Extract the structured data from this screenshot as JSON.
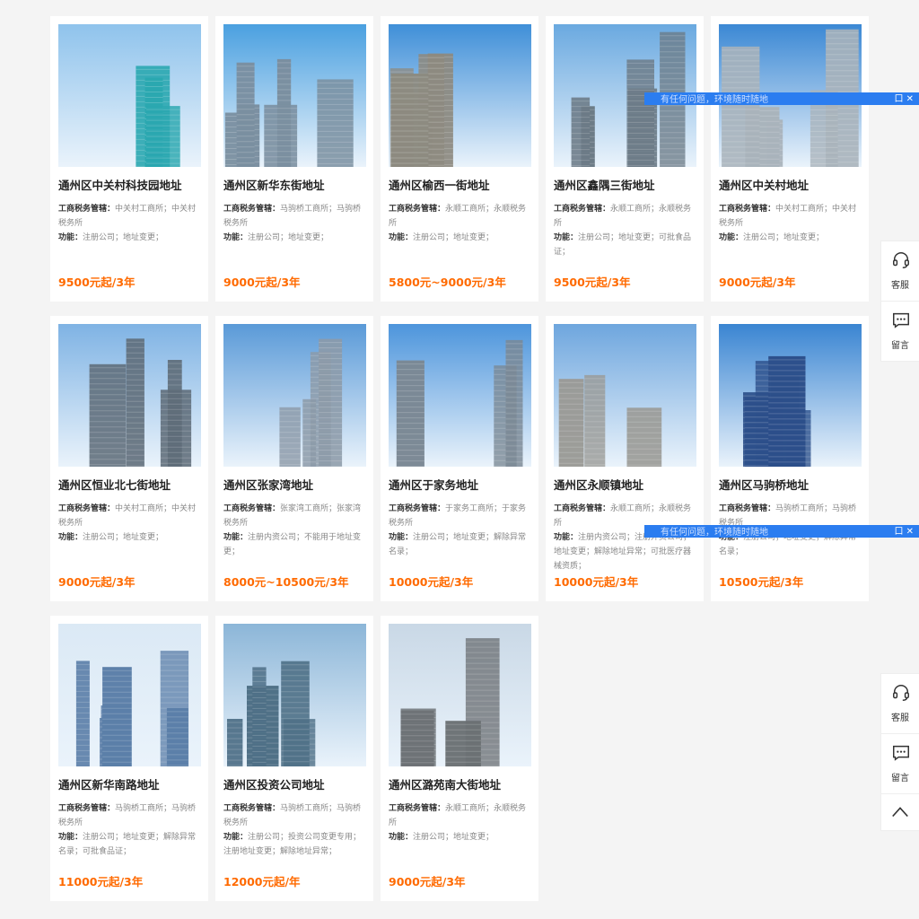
{
  "cards": [
    {
      "title": "通州区中关村科技园地址",
      "tax_label": "工商税务管辖：",
      "tax": "中关村工商所；中关村税务所",
      "func_label": "功能：",
      "func": "注册公司；地址变更；",
      "price": "9500元起/3年"
    },
    {
      "title": "通州区新华东街地址",
      "tax_label": "工商税务管辖：",
      "tax": "马驹桥工商所；马驹桥税务所",
      "func_label": "功能：",
      "func": "注册公司；地址变更；",
      "price": "9000元起/3年"
    },
    {
      "title": "通州区榆西一街地址",
      "tax_label": "工商税务管辖：",
      "tax": "永顺工商所；永顺税务所",
      "func_label": "功能：",
      "func": "注册公司；地址变更；",
      "price": "5800元~9000元/3年"
    },
    {
      "title": "通州区鑫隅三街地址",
      "tax_label": "工商税务管辖：",
      "tax": "永顺工商所；永顺税务所",
      "func_label": "功能：",
      "func": "注册公司；地址变更；可批食品证；",
      "price": "9500元起/3年"
    },
    {
      "title": "通州区中关村地址",
      "tax_label": "工商税务管辖：",
      "tax": "中关村工商所；中关村税务所",
      "func_label": "功能：",
      "func": "注册公司；地址变更；",
      "price": "9000元起/3年"
    },
    {
      "title": "通州区恒业北七街地址",
      "tax_label": "工商税务管辖：",
      "tax": "中关村工商所；中关村税务所",
      "func_label": "功能：",
      "func": "注册公司；地址变更；",
      "price": "9000元起/3年"
    },
    {
      "title": "通州区张家湾地址",
      "tax_label": "工商税务管辖：",
      "tax": "张家湾工商所；张家湾税务所",
      "func_label": "功能：",
      "func": "注册内资公司；不能用于地址变更；",
      "price": "8000元~10500元/3年"
    },
    {
      "title": "通州区于家务地址",
      "tax_label": "工商税务管辖：",
      "tax": "于家务工商所；于家务税务所",
      "func_label": "功能：",
      "func": "注册公司；地址变更；解除异常名录；",
      "price": "10000元起/3年"
    },
    {
      "title": "通州区永顺镇地址",
      "tax_label": "工商税务管辖：",
      "tax": "永顺工商所；永顺税务所",
      "func_label": "功能：",
      "func": "注册内资公司；注册外资公司；地址变更；解除地址异常；可批医疗器械资质；",
      "price": "10000元起/3年"
    },
    {
      "title": "通州区马驹桥地址",
      "tax_label": "工商税务管辖：",
      "tax": "马驹桥工商所；马驹桥税务所",
      "func_label": "功能：",
      "func": "注册公司；地址变更；解除异常名录；",
      "price": "10500元起/3年"
    },
    {
      "title": "通州区新华南路地址",
      "tax_label": "工商税务管辖：",
      "tax": "马驹桥工商所；马驹桥税务所",
      "func_label": "功能：",
      "func": "注册公司；地址变更；解除异常名录；可批食品证；",
      "price": "11000元起/3年"
    },
    {
      "title": "通州区投资公司地址",
      "tax_label": "工商税务管辖：",
      "tax": "马驹桥工商所；马驹桥税务所",
      "func_label": "功能：",
      "func": "注册公司；投资公司变更专用；注册地址变更；解除地址异常；",
      "price": "12000元起/年"
    },
    {
      "title": "通州区潞苑南大街地址",
      "tax_label": "工商税务管辖：",
      "tax": "永顺工商所；永顺税务所",
      "func_label": "功能：",
      "func": "注册公司；地址变更；",
      "price": "9000元起/3年"
    }
  ],
  "sidebar": {
    "service_label": "客服",
    "message_label": "留言"
  },
  "banner": {
    "text": "有任何问题，环境随时随地",
    "controls": "口 ✕"
  },
  "colors": {
    "price": "#ff6a00",
    "banner": "#2b7df0",
    "background": "#f4f4f4"
  }
}
